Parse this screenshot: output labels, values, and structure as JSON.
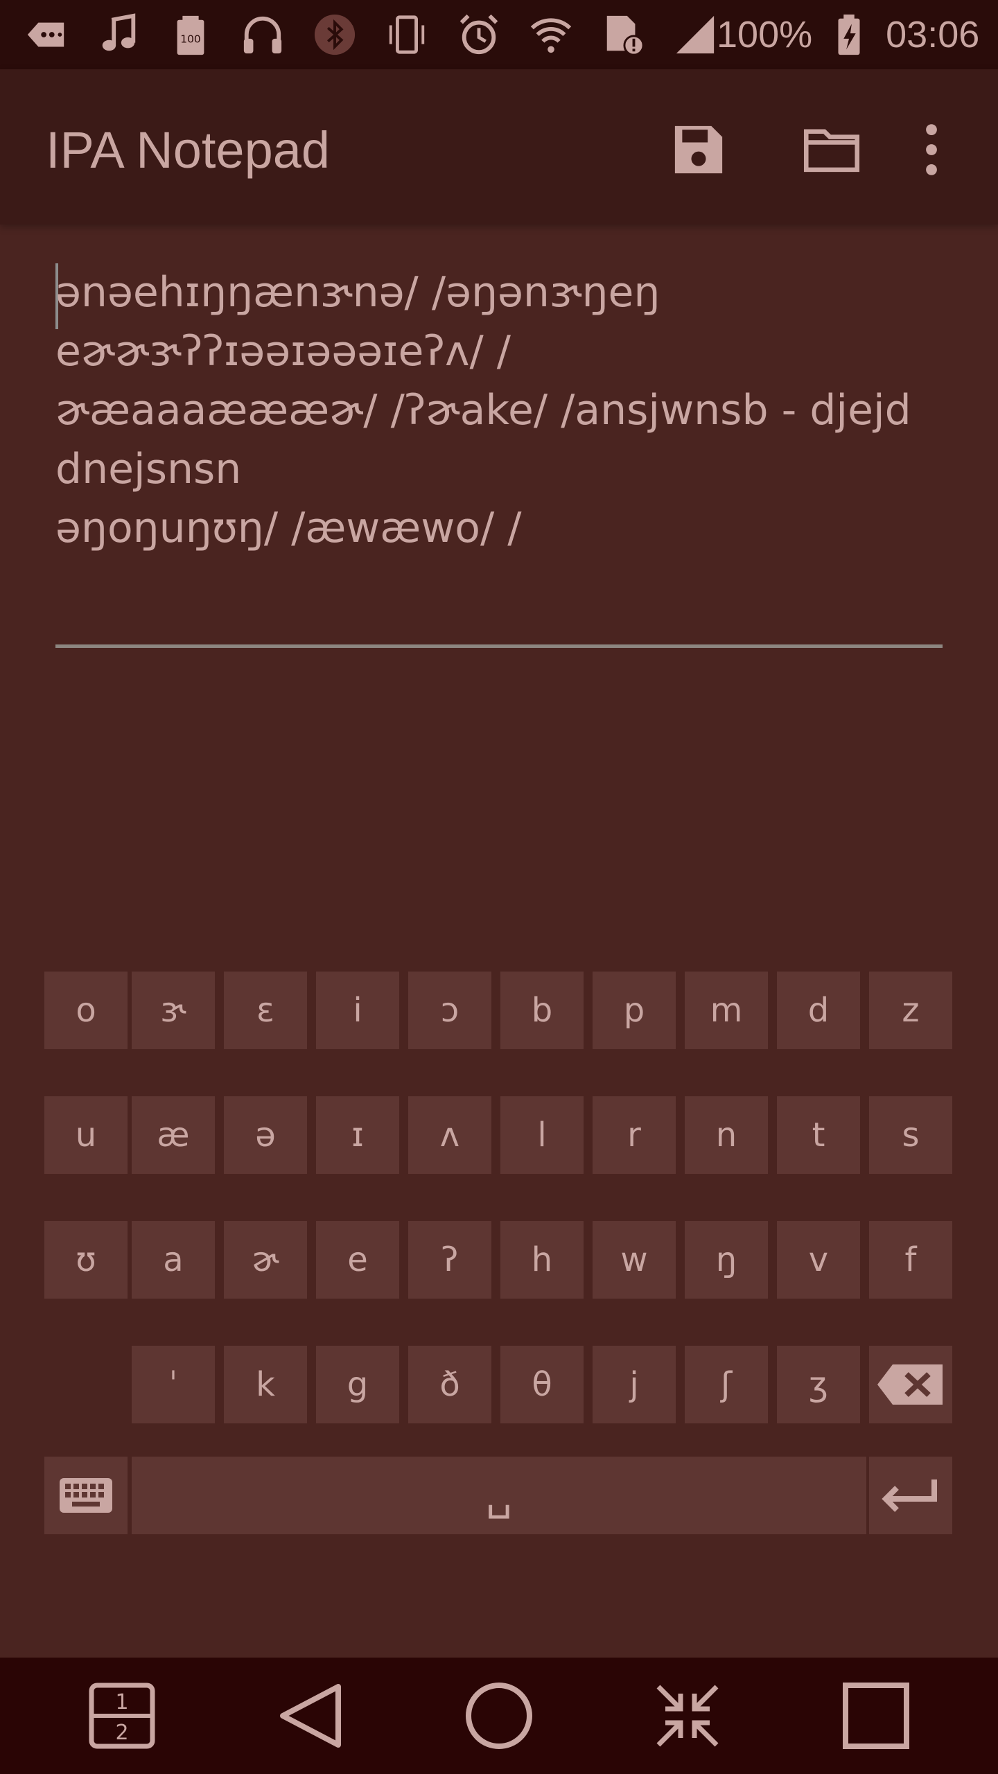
{
  "status_bar": {
    "icons_left": [
      "keyboard-tag-icon",
      "music-icon",
      "battery-100-icon",
      "headphones-icon",
      "bluetooth-icon",
      "vibrate-icon",
      "alarm-icon",
      "wifi-icon",
      "sim-alert-icon",
      "signal-icon"
    ],
    "battery_percent": "100%",
    "time": "03:06"
  },
  "app_bar": {
    "title": "IPA Notepad",
    "actions": [
      "save-icon",
      "folder-icon",
      "more-vert-icon"
    ]
  },
  "editor": {
    "lines": [
      "ənəehɪŋŋænɝnə/ /əŋənɝŋeŋ",
      "eɚɚɝʔʔɪəəɪəəəɪeʔʌ/ /",
      "ɚæaaaæææɚ/ /ʔɚake/ /ansjwnsb - djejd",
      "dnejsnsn",
      "əŋoŋuŋʊŋ/ /æwæwo/ /"
    ]
  },
  "keyboard": {
    "row1": [
      "o",
      "ɝ",
      "ɛ",
      "i",
      "ɔ",
      "b",
      "p",
      "m",
      "d",
      "z"
    ],
    "row2": [
      "u",
      "æ",
      "ə",
      "ɪ",
      "ʌ",
      "l",
      "r",
      "n",
      "t",
      "s"
    ],
    "row3": [
      "ʊ",
      "a",
      "ɚ",
      "e",
      "ʔ",
      "h",
      "w",
      "ŋ",
      "v",
      "f"
    ],
    "row4": [
      "ˈ",
      "k",
      "g",
      "ð",
      "θ",
      "j",
      "ʃ",
      "ʒ"
    ],
    "space_label": "␣",
    "special_keys": [
      "backspace-icon",
      "keyboard-switch-icon",
      "enter-icon"
    ]
  },
  "nav_bar": {
    "buttons": [
      "dual-window-icon",
      "back-icon",
      "home-icon",
      "collapse-icon",
      "recents-icon"
    ],
    "dual_top": "1",
    "dual_bottom": "2"
  },
  "colors": {
    "background": "#4a2420",
    "status_bar": "#2a0c0a",
    "app_bar": "#3b1a17",
    "key": "#5e3632",
    "text": "#c9a6a2",
    "nav_bar": "#2a0505"
  }
}
